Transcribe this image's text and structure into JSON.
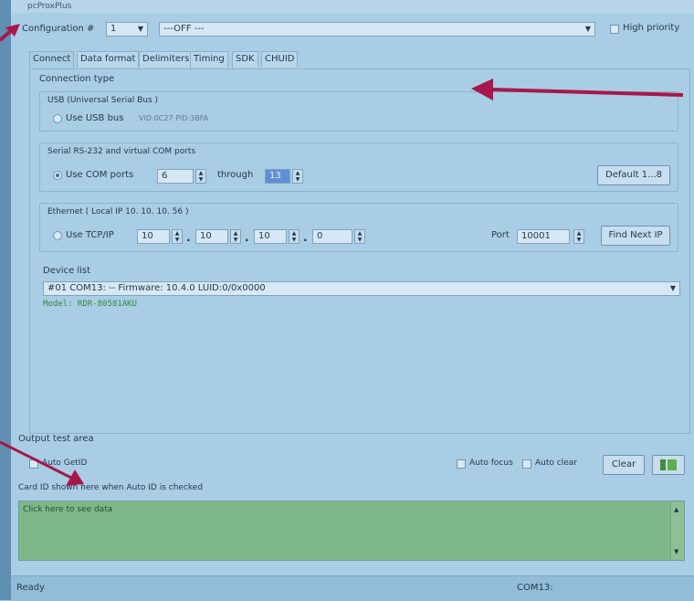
{
  "window": {
    "title": "pcProxPlus"
  },
  "config": {
    "label": "Configuration #",
    "number": "1",
    "mode": "---OFF ---",
    "high_priority_label": "High priority"
  },
  "tabs": [
    {
      "label": "Connect"
    },
    {
      "label": "Data format"
    },
    {
      "label": "Delimiters"
    },
    {
      "label": "Timing"
    },
    {
      "label": "SDK"
    },
    {
      "label": "CHUID"
    }
  ],
  "connect": {
    "connection_type_label": "Connection type",
    "usb": {
      "group_label": "USB (Universal Serial Bus )",
      "radio_label": "Use USB bus",
      "vid_pid": "VID:0C27 PID:3BFA"
    },
    "serial": {
      "group_label": "Serial RS-232 and virtual COM ports",
      "radio_label": "Use COM ports",
      "from": "6",
      "through_label": "through",
      "to": "13",
      "default_button": "Default 1...8"
    },
    "ethernet": {
      "group_label": "Ethernet ( Local IP 10. 10. 10. 56 )",
      "radio_label": "Use TCP/IP",
      "ip": [
        "10",
        "10",
        "10",
        "0"
      ],
      "port_label": "Port",
      "port": "10001",
      "find_button": "Find Next IP"
    },
    "device_list": {
      "label": "Device list",
      "selected": "#01 COM13: -- Firmware: 10.4.0 LUID:0/0x0000",
      "model": "Model: RDR-80581AKU"
    }
  },
  "output": {
    "label": "Output test area",
    "auto_getid": "Auto GetID",
    "auto_focus": "Auto focus",
    "auto_clear": "Auto clear",
    "clear_button": "Clear",
    "hint": "Card ID shown here when Auto ID is checked",
    "text": "Click here to see data"
  },
  "status": {
    "left": "Ready",
    "port": "COM13:"
  },
  "colors": {
    "annotation_arrow": "#a8174a",
    "output_bg": "#7eb888",
    "model_text": "#2f8a3f"
  }
}
